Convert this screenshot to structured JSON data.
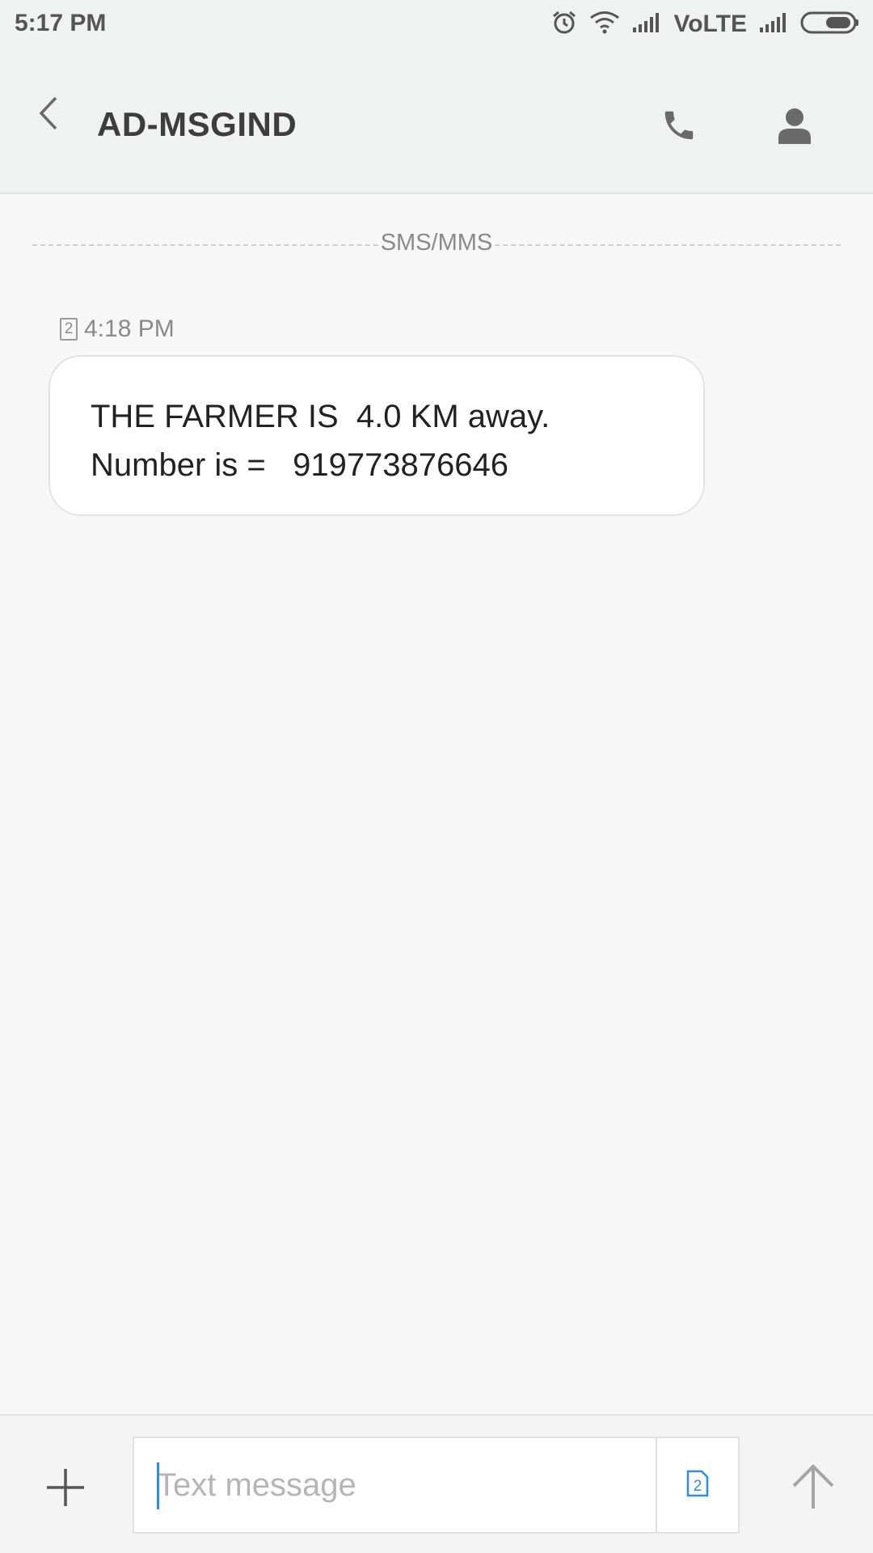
{
  "status_bar": {
    "time": "5:17 PM",
    "network_label": "VoLTE",
    "icons": [
      "alarm-icon",
      "wifi-icon",
      "signal-icon",
      "signal-icon",
      "battery-icon"
    ]
  },
  "header": {
    "title": "AD-MSGIND",
    "icons": [
      "back-arrow-icon",
      "phone-icon",
      "person-icon"
    ]
  },
  "conversation": {
    "channel_label": "SMS/MMS",
    "messages": [
      {
        "sim": "2",
        "time": "4:18 PM",
        "lines": [
          "THE FARMER IS  4.0 KM away.",
          "Number is =   919773876646"
        ]
      }
    ]
  },
  "composer": {
    "placeholder": "Text message",
    "sim": "2",
    "icons": [
      "plus-icon",
      "sim-icon",
      "send-arrow-icon"
    ]
  },
  "colors": {
    "background": "#f7f7f7",
    "bar": "#f0f1f1",
    "accent": "#2a8fe0",
    "icon_gray": "#6a6a6a"
  }
}
